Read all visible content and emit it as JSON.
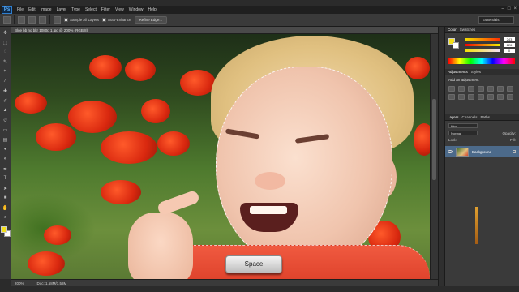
{
  "app": {
    "logo": "Ps",
    "menu": [
      "File",
      "Edit",
      "Image",
      "Layer",
      "Type",
      "Select",
      "Filter",
      "View",
      "Window",
      "Help"
    ],
    "window_controls": [
      "–",
      "□",
      "×"
    ]
  },
  "options": {
    "sample_all_layers": "Sample All Layers",
    "auto_enhance": "Auto-Enhance",
    "refine_edge": "Refine Edge...",
    "workspace": "Essentials"
  },
  "document": {
    "tab_title": "Blue bb no bkr 1080p 1.jpg @ 200% (RGB/8)",
    "zoom": "200%",
    "doc_size": "Doc: 1.58M/1.58M"
  },
  "overlay": {
    "key_label": "Space"
  },
  "panels": {
    "color_tabs": [
      "Color",
      "Swatches"
    ],
    "color_values": {
      "r": "243",
      "g": "226",
      "b": "0"
    },
    "adjustments_tabs": [
      "Adjustments",
      "Styles"
    ],
    "adjustments_title": "Add an adjustment",
    "layers_tabs": [
      "Layers",
      "Channels",
      "Paths"
    ],
    "kind_label": "Kind",
    "blend_mode": "Normal",
    "opacity_label": "Opacity:",
    "lock_label": "Lock:",
    "fill_label": "Fill:",
    "layer_name": "Background"
  },
  "colors": {
    "foreground": "#f3e01a",
    "background": "#ffffff",
    "accent": "#4c6a8a"
  },
  "icons": [
    "move-icon",
    "marquee-icon",
    "lasso-icon",
    "quick-selection-icon",
    "crop-icon",
    "eyedropper-icon",
    "healing-icon",
    "brush-icon",
    "clone-stamp-icon",
    "history-brush-icon",
    "eraser-icon",
    "gradient-icon",
    "blur-icon",
    "dodge-icon",
    "pen-icon",
    "type-icon",
    "path-selection-icon",
    "shape-icon",
    "hand-icon",
    "zoom-icon"
  ]
}
